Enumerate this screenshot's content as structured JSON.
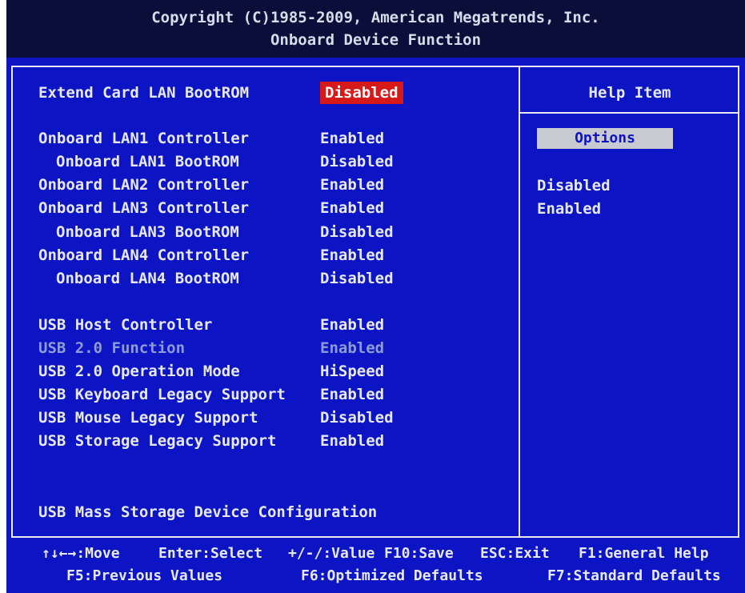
{
  "header": {
    "copyright": "Copyright (C)1985-2009, American Megatrends, Inc.",
    "title": "Onboard Device Function"
  },
  "settings": [
    {
      "label": "Extend Card LAN BootROM",
      "value": "Disabled",
      "selected": true
    },
    {
      "label": "Onboard LAN1 Controller",
      "value": "Enabled"
    },
    {
      "label": "Onboard LAN1 BootROM",
      "value": "Disabled"
    },
    {
      "label": "Onboard LAN2 Controller",
      "value": "Enabled"
    },
    {
      "label": "Onboard LAN3 Controller",
      "value": "Enabled"
    },
    {
      "label": "Onboard LAN3 BootROM",
      "value": "Disabled"
    },
    {
      "label": "Onboard LAN4 Controller",
      "value": "Enabled"
    },
    {
      "label": "Onboard LAN4 BootROM",
      "value": "Disabled"
    },
    {
      "label": "USB Host Controller",
      "value": "Enabled"
    },
    {
      "label": "USB 2.0 Function",
      "value": "Enabled",
      "greyed": true
    },
    {
      "label": "USB 2.0 Operation Mode",
      "value": "HiSpeed"
    },
    {
      "label": "USB Keyboard Legacy Support",
      "value": "Enabled"
    },
    {
      "label": "USB Mouse Legacy Support",
      "value": "Disabled"
    },
    {
      "label": "USB Storage Legacy Support",
      "value": "Enabled"
    },
    {
      "label": "USB Mass Storage Device Configuration"
    }
  ],
  "help": {
    "title": "Help Item",
    "options_header": "Options",
    "options": [
      "Disabled",
      "Enabled"
    ]
  },
  "footer": {
    "move": "↑↓←→:Move",
    "select": "Enter:Select",
    "value": "+/-/:Value",
    "save": "F10:Save",
    "exit": "ESC:Exit",
    "help": "F1:General Help",
    "prev": "F5:Previous Values",
    "optimized": "F6:Optimized Defaults",
    "standard": "F7:Standard Defaults"
  },
  "colors": {
    "background": "#0d14c4",
    "header": "#0a0f3a",
    "selected": "#d61a1a",
    "text": "#e6e8f4",
    "greyed_text": "#8f9bd6"
  }
}
